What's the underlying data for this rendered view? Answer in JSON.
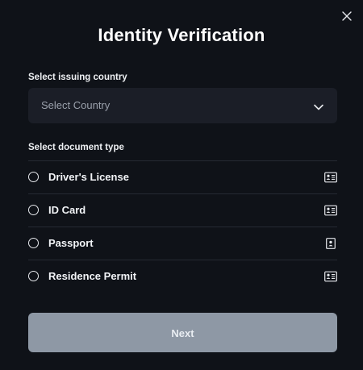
{
  "dialog": {
    "title": "Identity Verification",
    "close_icon": "close-icon"
  },
  "country": {
    "label": "Select issuing country",
    "placeholder": "Select Country",
    "icon": "chevron-down-icon"
  },
  "document": {
    "label": "Select document type",
    "options": [
      {
        "label": "Driver's License",
        "icon": "id-card-icon",
        "selected": false
      },
      {
        "label": "ID Card",
        "icon": "id-card-icon",
        "selected": false
      },
      {
        "label": "Passport",
        "icon": "passport-icon",
        "selected": false
      },
      {
        "label": "Residence Permit",
        "icon": "id-card-icon",
        "selected": false
      }
    ]
  },
  "actions": {
    "next_label": "Next"
  },
  "colors": {
    "background": "#0f1218",
    "select_bg": "#1b1e27",
    "divider": "#262a33",
    "button_bg": "#8e98a5",
    "text": "#ffffff",
    "placeholder": "#9aa0ab"
  }
}
